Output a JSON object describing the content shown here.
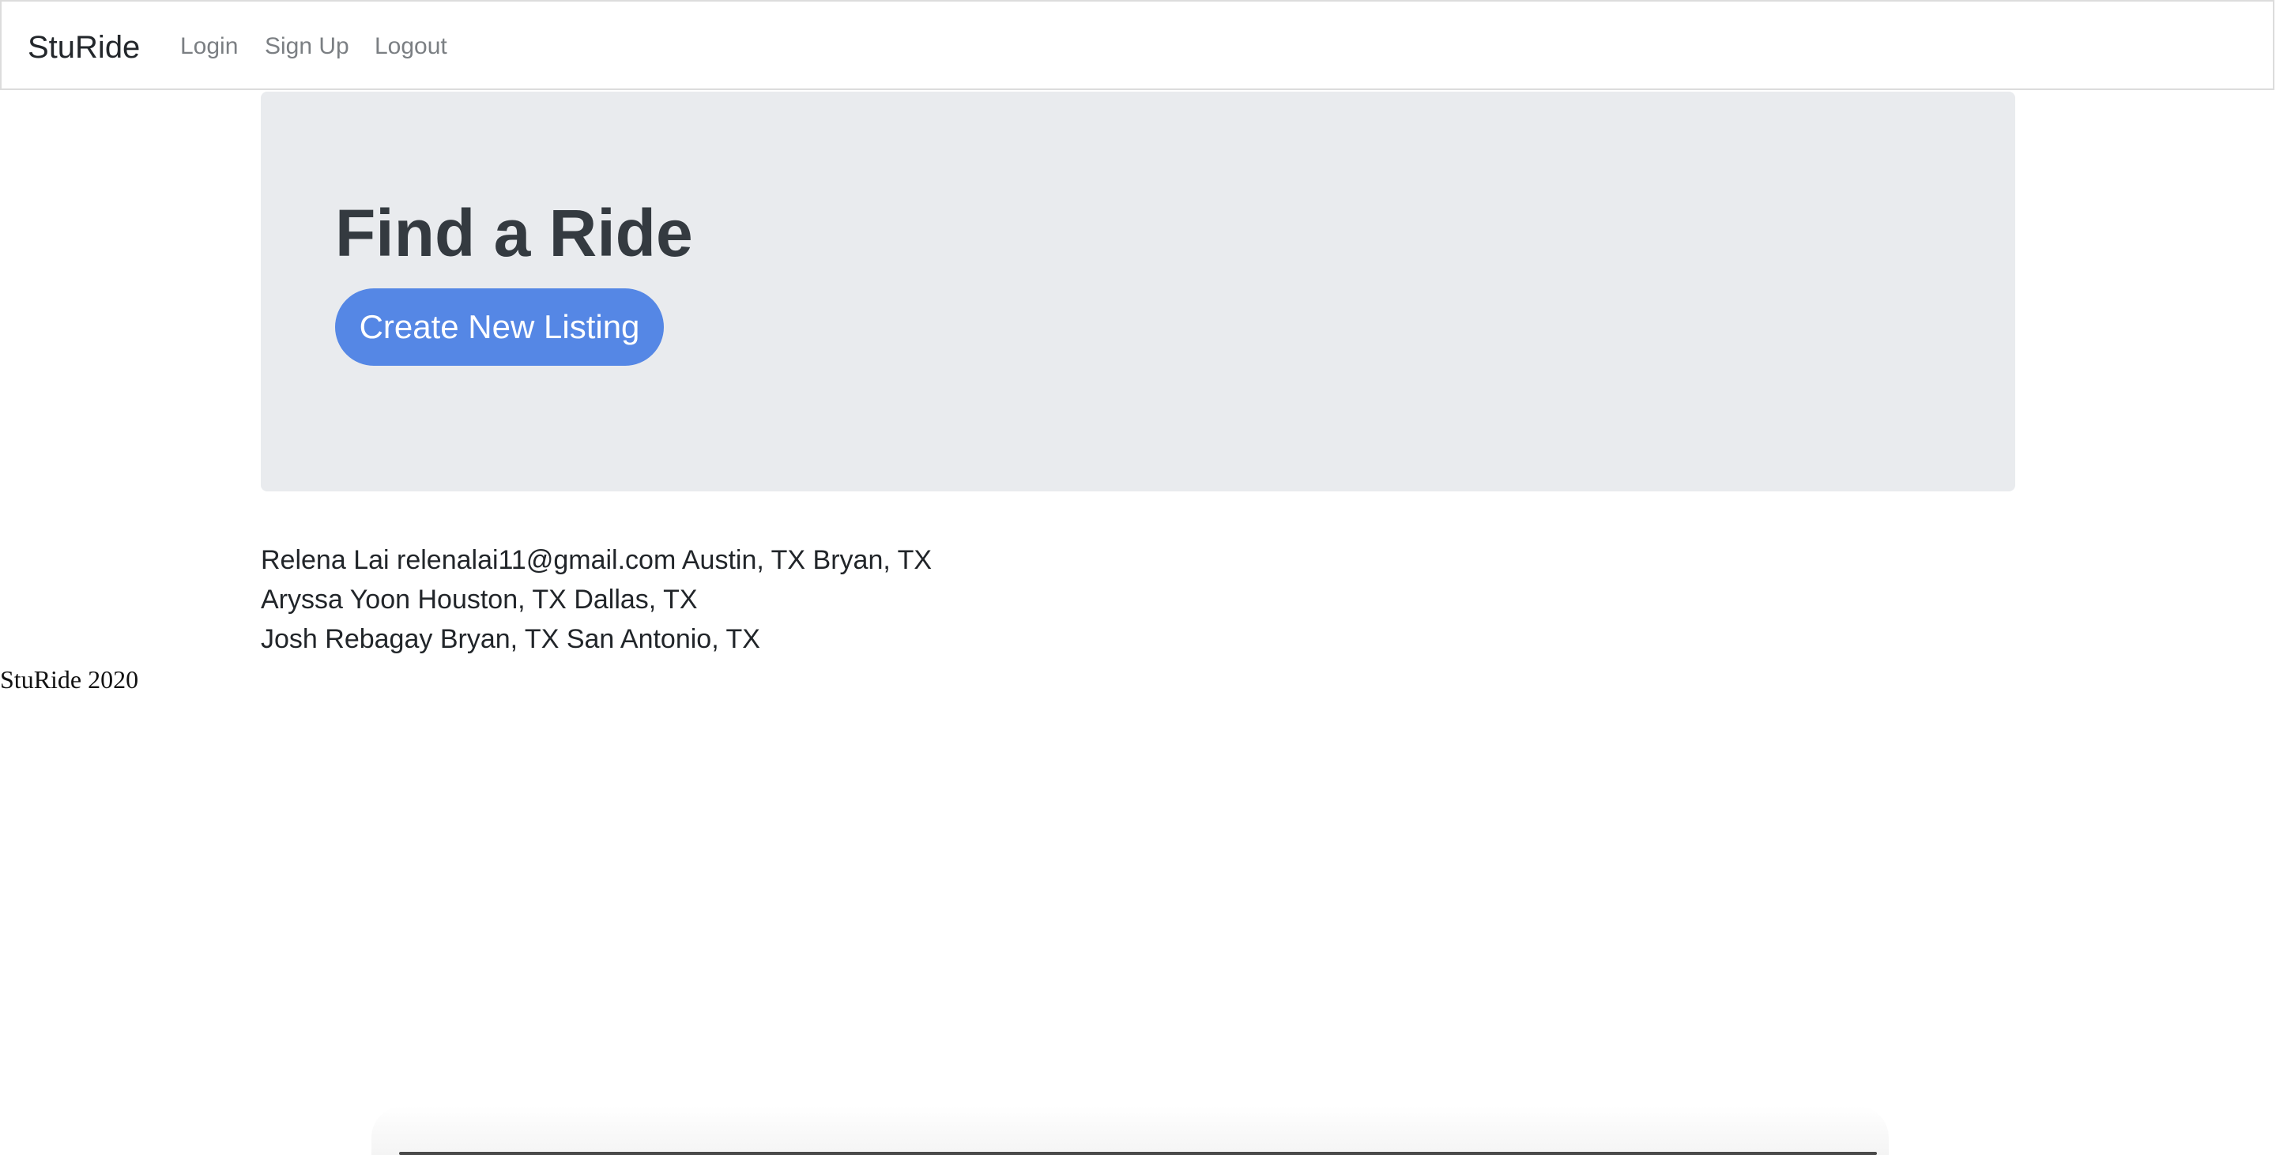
{
  "navbar": {
    "brand": "StuRide",
    "links": [
      {
        "label": "Login"
      },
      {
        "label": "Sign Up"
      },
      {
        "label": "Logout"
      }
    ]
  },
  "hero": {
    "title": "Find a Ride",
    "button_label": "Create New Listing",
    "button_color": "#5587e5"
  },
  "listings": [
    {
      "name": "Relena Lai",
      "email": "relenalai11@gmail.com",
      "from": "Austin, TX",
      "to": "Bryan, TX"
    },
    {
      "name": "Aryssa Yoon",
      "email": "",
      "from": "Houston, TX",
      "to": "Dallas, TX"
    },
    {
      "name": "Josh Rebagay",
      "email": "",
      "from": "Bryan, TX",
      "to": "San Antonio, TX"
    }
  ],
  "footer": {
    "text": "StuRide 2020"
  }
}
